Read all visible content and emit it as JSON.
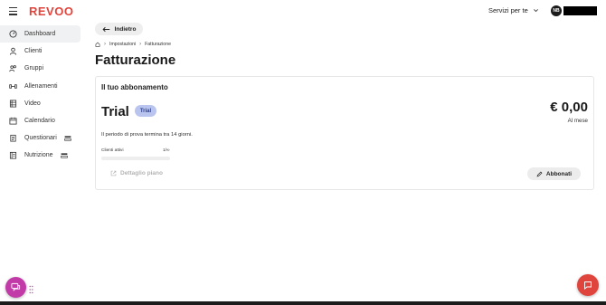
{
  "app": {
    "logo": "REVOO"
  },
  "header": {
    "services_label": "Servizi per te",
    "avatar_initials": "NB"
  },
  "sidebar": {
    "items": [
      {
        "label": "Dashboard",
        "icon": "gauge-icon",
        "active": true
      },
      {
        "label": "Clienti",
        "icon": "user-icon"
      },
      {
        "label": "Gruppi",
        "icon": "group-icon"
      },
      {
        "label": "Allenamenti",
        "icon": "dumbbell-icon"
      },
      {
        "label": "Video",
        "icon": "film-icon"
      },
      {
        "label": "Calendario",
        "icon": "calendar-icon"
      },
      {
        "label": "Questionari",
        "icon": "clipboard-icon",
        "extra": "stack-icon"
      },
      {
        "label": "Nutrizione",
        "icon": "book-icon",
        "extra": "stack-icon"
      }
    ]
  },
  "main": {
    "back_label": "Indietro",
    "breadcrumb": {
      "home": "home-icon",
      "items": [
        "Impostazioni",
        "Fatturazione"
      ]
    },
    "title": "Fatturazione",
    "subscription": {
      "section_title": "Il tuo abbonamento",
      "plan_name": "Trial",
      "plan_badge": "Trial",
      "price": "€ 0,00",
      "period": "Al mese",
      "trial_note": "Il periodo di prova termina tra 14 giorni.",
      "clients_label": "Clienti attivi",
      "clients_count": "1/∞",
      "clients_progress": 0,
      "detail_link": "Dettaglio piano",
      "subscribe_label": "Abbonati"
    }
  },
  "colors": {
    "brand": "#e0453d",
    "chat_fab": "#c23aa8",
    "badge_bg": "#b9c5ef"
  }
}
